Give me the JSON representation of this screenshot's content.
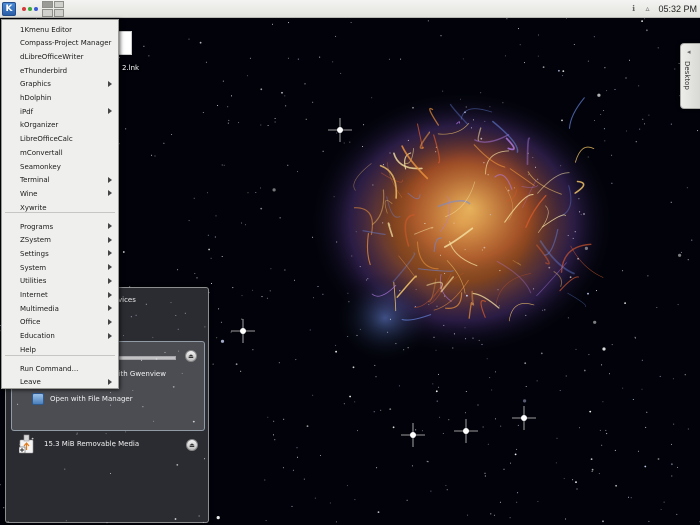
{
  "panel": {
    "clock": "05:32 PM"
  },
  "desktop": {
    "file_label": "2.lnk",
    "toolbox_label": "Desktop"
  },
  "kmenu": {
    "apps": [
      {
        "label": "1Kmenu Editor",
        "submenu": false
      },
      {
        "label": "Compass-Project Manager",
        "submenu": false
      },
      {
        "label": "dLibreOfficeWriter",
        "submenu": false
      },
      {
        "label": "eThunderbird",
        "submenu": false
      },
      {
        "label": "Graphics",
        "submenu": true
      },
      {
        "label": "hDolphin",
        "submenu": false
      },
      {
        "label": "iPdf",
        "submenu": true
      },
      {
        "label": "kOrganizer",
        "submenu": false
      },
      {
        "label": "LibreOfficeCalc",
        "submenu": false
      },
      {
        "label": "mConvertall",
        "submenu": false
      },
      {
        "label": "Seamonkey",
        "submenu": false
      },
      {
        "label": "Terminal",
        "submenu": true
      },
      {
        "label": "Wine",
        "submenu": true
      },
      {
        "label": "Xywrite",
        "submenu": false
      }
    ],
    "categories": [
      {
        "label": "Programs",
        "submenu": true
      },
      {
        "label": "ZSystem",
        "submenu": true
      },
      {
        "label": "Settings",
        "submenu": true
      },
      {
        "label": "System",
        "submenu": true
      },
      {
        "label": "Utilities",
        "submenu": true
      },
      {
        "label": "Internet",
        "submenu": true
      },
      {
        "label": "Multimedia",
        "submenu": true
      },
      {
        "label": "Office",
        "submenu": true
      },
      {
        "label": "Education",
        "submenu": true
      },
      {
        "label": "Help",
        "submenu": false
      }
    ],
    "session": [
      {
        "label": "Run Command...",
        "submenu": false
      },
      {
        "label": "Leave",
        "submenu": true
      }
    ]
  },
  "device_notifier": {
    "title": "vices",
    "actions": {
      "gwenview": "Download Photos with Gwenview",
      "file_manager": "Open with File Manager"
    },
    "removable_media": "15.3 MiB Removable Media",
    "usage_fraction": 1.0
  },
  "colors": {
    "menu_bg": "#efefed",
    "panel_bg": "#e8e8e4",
    "accent": "#2a5fa8"
  }
}
